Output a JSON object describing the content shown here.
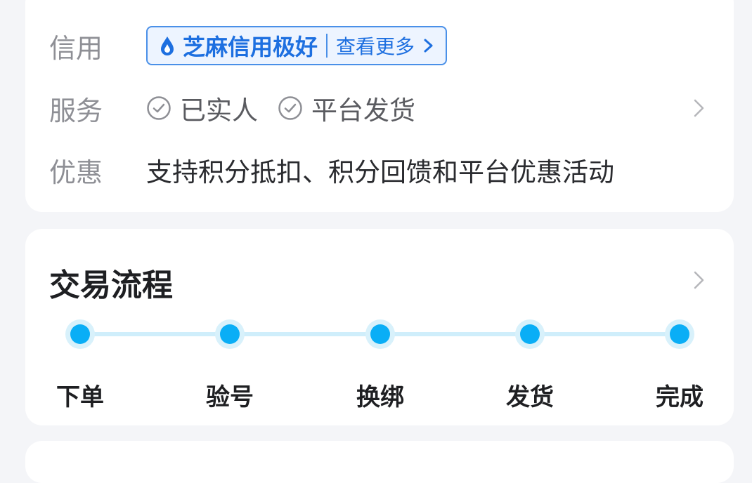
{
  "info": {
    "credit": {
      "label": "信用",
      "badge_text": "芝麻信用极好",
      "more_text": "查看更多"
    },
    "service": {
      "label": "服务",
      "items": [
        "已实人",
        "平台发货"
      ]
    },
    "promo": {
      "label": "优惠",
      "text": "支持积分抵扣、积分回馈和平台优惠活动"
    }
  },
  "flow": {
    "title": "交易流程",
    "steps": [
      "下单",
      "验号",
      "换绑",
      "发货",
      "完成"
    ]
  },
  "colors": {
    "accent": "#1d6fe0",
    "step_dot": "#0aaef6",
    "track": "#cfeefb"
  }
}
